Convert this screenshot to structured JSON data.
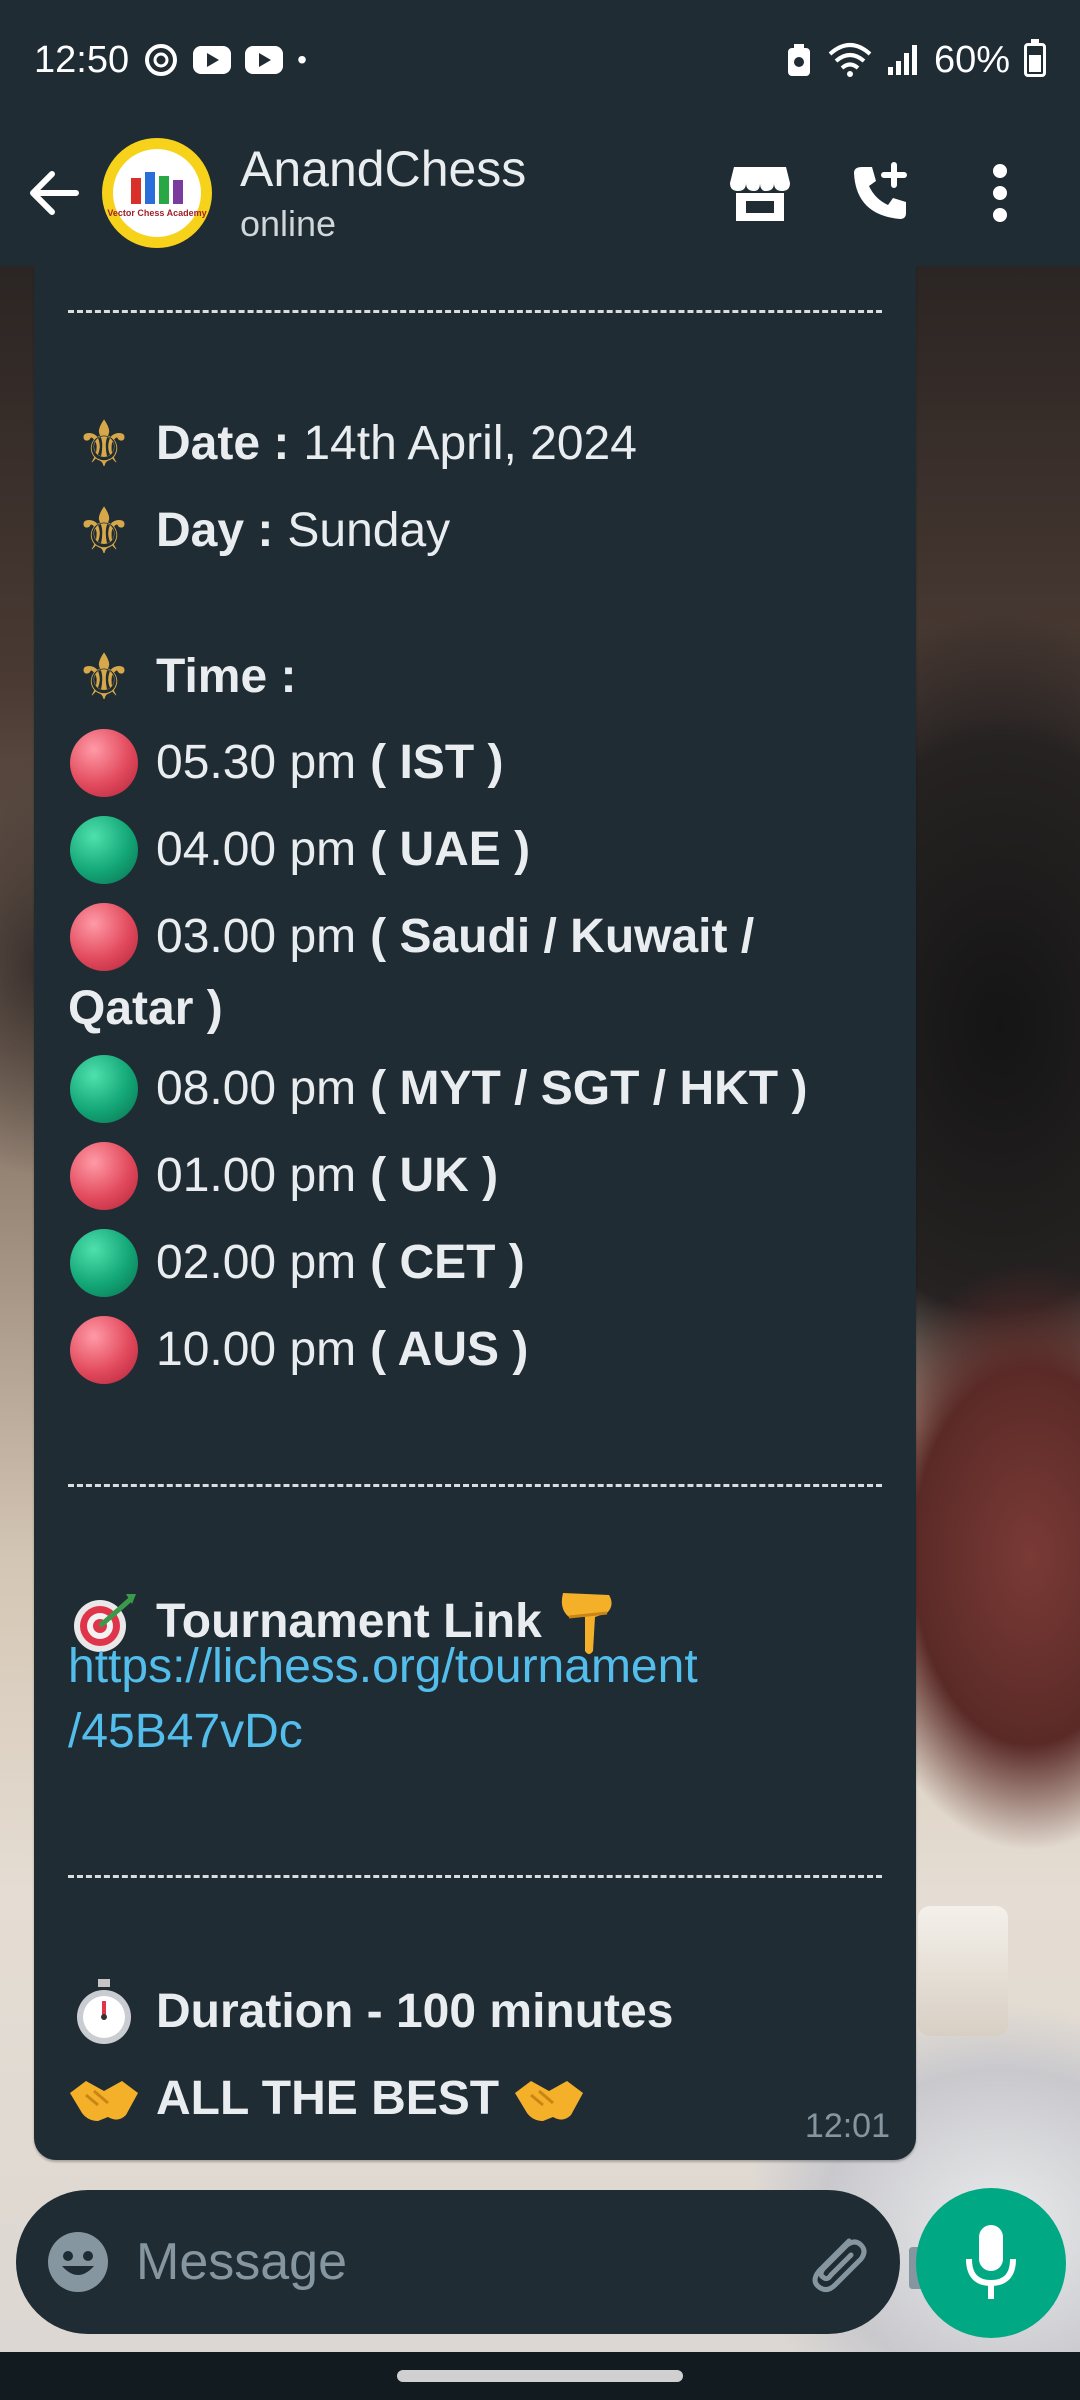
{
  "status_bar": {
    "time": "12:50",
    "bullet": "•",
    "battery": "60%"
  },
  "header": {
    "contact_name": "AnandChess",
    "contact_status": "online",
    "avatar_text": "Vector Chess Academy"
  },
  "message": {
    "divider": "--------------------------------------------------------",
    "date_label": "Date :",
    "date_value": "14th April, 2024",
    "day_label": "Day :",
    "day_value": "Sunday",
    "time_label": "Time :",
    "times": [
      {
        "time": "05.30 pm",
        "zone": "( IST )",
        "color": "red"
      },
      {
        "time": "04.00 pm",
        "zone": "( UAE )",
        "color": "green"
      },
      {
        "time": "03.00 pm",
        "zone": "( Saudi / Kuwait /",
        "zone_cont": "Qatar )",
        "color": "red"
      },
      {
        "time": "08.00 pm",
        "zone": "( MYT / SGT / HKT )",
        "color": "green"
      },
      {
        "time": "01.00 pm",
        "zone": "( UK )",
        "color": "red"
      },
      {
        "time": "02.00 pm",
        "zone": "( CET )",
        "color": "green"
      },
      {
        "time": "10.00 pm",
        "zone": "( AUS )",
        "color": "red"
      }
    ],
    "link_label": "Tournament Link",
    "link_line1": "https://lichess.org/tournament",
    "link_line2": "/45B47vDc",
    "duration": "Duration - 100 minutes",
    "closing": "ALL THE BEST",
    "timestamp": "12:01"
  },
  "composer": {
    "placeholder": "Message"
  },
  "colors": {
    "accent": "#00a884",
    "link": "#53bdeb",
    "bubble": "#1f2c34",
    "header": "#1f2c33"
  }
}
